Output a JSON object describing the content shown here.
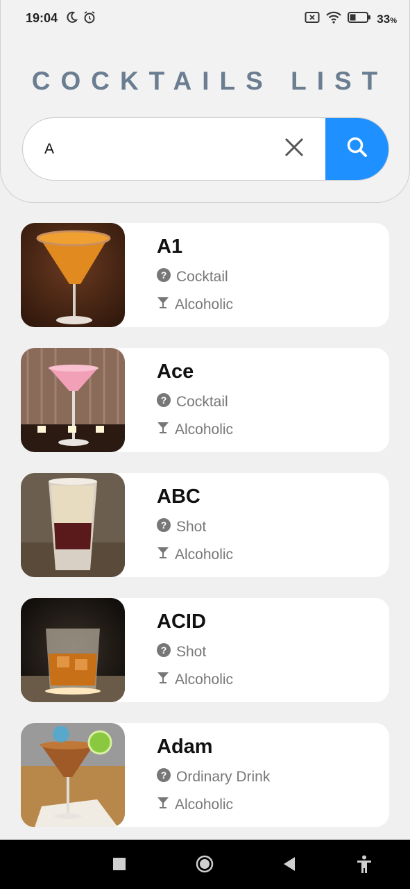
{
  "status": {
    "time": "19:04",
    "battery": "33",
    "battery_unit": "%"
  },
  "header": {
    "title": "COCKTAILS LIST"
  },
  "search": {
    "value": "A"
  },
  "labels": {
    "question_icon": "question-circle-icon",
    "glass_icon": "cocktail-glass-icon"
  },
  "cocktails": [
    {
      "name": "A1",
      "category": "Cocktail",
      "alcoholic": "Alcoholic"
    },
    {
      "name": "Ace",
      "category": "Cocktail",
      "alcoholic": "Alcoholic"
    },
    {
      "name": "ABC",
      "category": "Shot",
      "alcoholic": "Alcoholic"
    },
    {
      "name": "ACID",
      "category": "Shot",
      "alcoholic": "Alcoholic"
    },
    {
      "name": "Adam",
      "category": "Ordinary Drink",
      "alcoholic": "Alcoholic"
    }
  ],
  "colors": {
    "accent": "#1e90ff",
    "title": "#6b7d90"
  }
}
